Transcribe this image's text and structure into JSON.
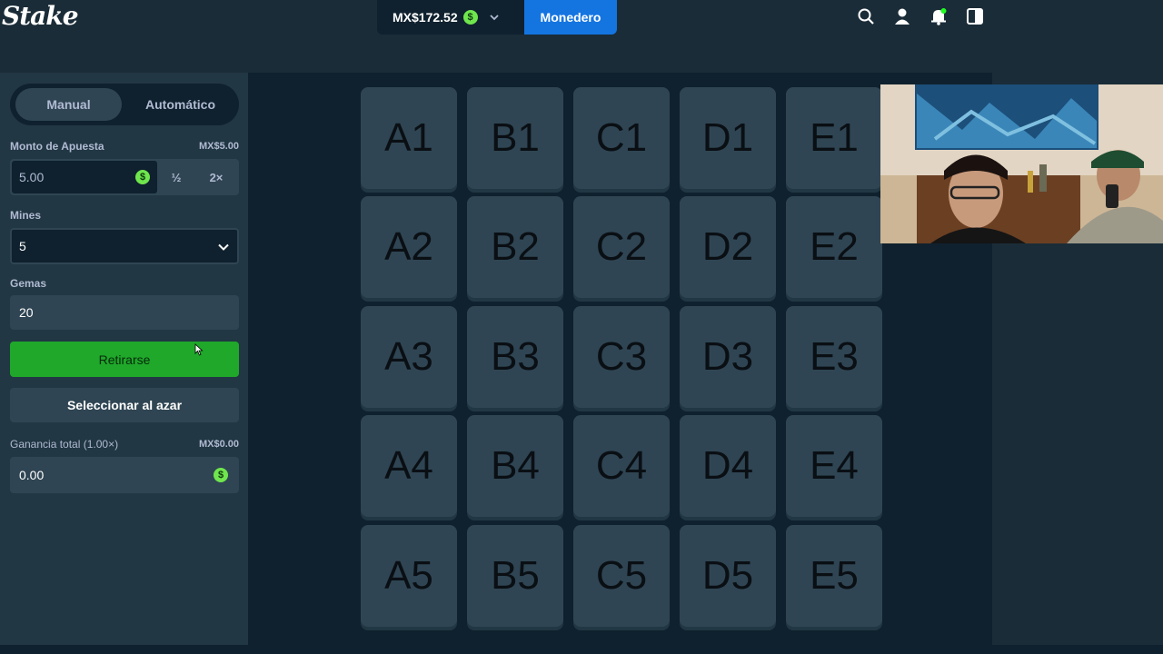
{
  "header": {
    "logo": "Stake",
    "balance": "MX$172.52",
    "coin_symbol": "$",
    "wallet_label": "Monedero",
    "icons": [
      "search-icon",
      "user-icon",
      "notification-icon",
      "sidebar-toggle-icon"
    ]
  },
  "sidebar": {
    "tabs": {
      "manual": "Manual",
      "auto": "Automático"
    },
    "bet": {
      "label": "Monto de Apuesta",
      "aside": "MX$5.00",
      "value": "5.00",
      "half": "½",
      "double": "2×"
    },
    "mines": {
      "label": "Mines",
      "value": "5"
    },
    "gems": {
      "label": "Gemas",
      "value": "20"
    },
    "cashout_label": "Retirarse",
    "random_label": "Seleccionar al azar",
    "profit": {
      "label": "Ganancia total (1.00×)",
      "aside": "MX$0.00",
      "value": "0.00"
    }
  },
  "grid": {
    "rows": [
      [
        "A1",
        "B1",
        "C1",
        "D1",
        "E1"
      ],
      [
        "A2",
        "B2",
        "C2",
        "D2",
        "E2"
      ],
      [
        "A3",
        "B3",
        "C3",
        "D3",
        "E3"
      ],
      [
        "A4",
        "B4",
        "C4",
        "D4",
        "E4"
      ],
      [
        "A5",
        "B5",
        "C5",
        "D5",
        "E5"
      ]
    ]
  },
  "colors": {
    "background": "#1a2c38",
    "panel": "#213743",
    "tile": "#2f4553",
    "accent_blue": "#1475e1",
    "accent_green": "#1fa82a",
    "coin_green": "#6fe64d"
  }
}
